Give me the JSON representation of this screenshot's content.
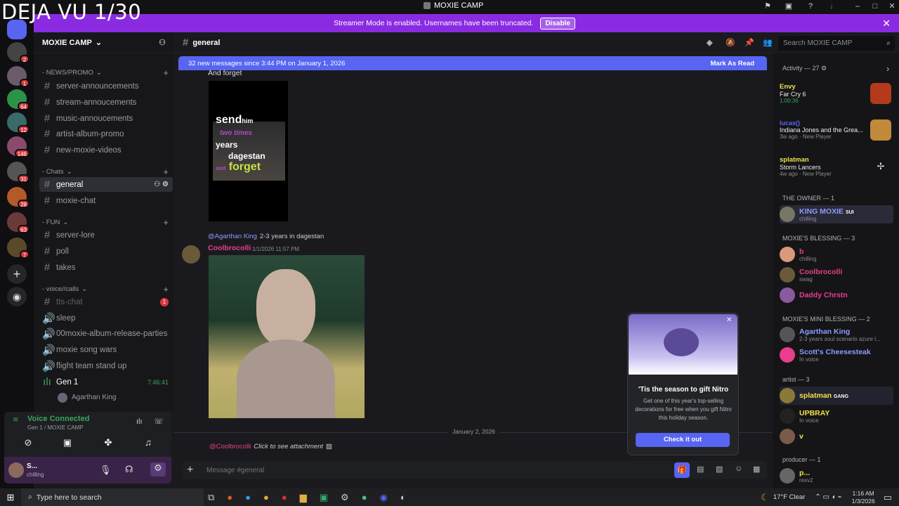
{
  "watermark": "DEJA VU 1/30",
  "window": {
    "title": "MOXIE CAMP"
  },
  "streamer": {
    "text": "Streamer Mode is enabled. Usernames have been truncated.",
    "button": "Disable"
  },
  "server": {
    "name": "MOXIE CAMP"
  },
  "guild_badges": [
    "2",
    "1",
    "64",
    "12",
    "146",
    "31",
    "28",
    "63",
    "7"
  ],
  "categories": {
    "news": "- NEWS/PROMO",
    "chats": "- Chats",
    "fun": "- FUN",
    "voice": "- voice//calls"
  },
  "channels": {
    "news": [
      "server-announcements",
      "stream-annoucements",
      "music-annoucements",
      "artist-album-promo",
      "new-moxie-videos"
    ],
    "chats": [
      "general",
      "moxie-chat"
    ],
    "fun": [
      "server-lore",
      "poll",
      "takes"
    ],
    "voice": [
      "tts-chat",
      "sleep",
      "00moxie-album-release-parties",
      "moxie song wars",
      "flight team stand up"
    ]
  },
  "tts_badge": "1",
  "voice_channel": {
    "name": "Gen 1",
    "timer": "7:46:41",
    "member": "Agarthan King"
  },
  "voice_status": {
    "title": "Voice Connected",
    "sub": "Gen 1 / MOXIE CAMP"
  },
  "user": {
    "name": "S...",
    "status": "chilling"
  },
  "channel_header": "general",
  "new_messages": {
    "text": "32 new messages since 3:44 PM on January 1, 2026",
    "action": "Mark As Read"
  },
  "search": {
    "placeholder": "Search MOXIE CAMP"
  },
  "messages": {
    "top_caption": "And forget",
    "meme_text": [
      "send",
      "him",
      "two times",
      "years",
      "dagestan",
      "and",
      "forget"
    ],
    "reply_target": "@Agarthan King",
    "reply_text": "2-3 years in dagestan",
    "author": "Coolbrocolli",
    "time": "1/1/2026 11:57 PM",
    "date_divider": "January 2, 2026",
    "reply2_target": "@Coolbrocolli",
    "reply2_text": "Click to see attachment"
  },
  "composer": {
    "placeholder": "Message #general"
  },
  "nitro_popup": {
    "title": "'Tis the season to gift Nitro",
    "body": "Get one of this year's top-selling decorations for free when you gift Nitro this holiday season.",
    "button": "Check it out"
  },
  "activity": {
    "header": "Activity — 27",
    "items": [
      {
        "user": "Envy",
        "game": "Far Cry 6",
        "meta": "1:00:36"
      },
      {
        "user": "lucas()",
        "game": "Indiana Jones and the Grea...",
        "meta": "3w ago · New Player"
      },
      {
        "user": "splatman",
        "game": "Storm Lancers",
        "meta": "4w ago · New Player"
      }
    ]
  },
  "member_groups": [
    {
      "header": "THE OWNER — 1",
      "members": [
        {
          "name": "KING MOXIE",
          "tag": "SUI",
          "status": "chilling",
          "color": "#8b9cff"
        }
      ]
    },
    {
      "header": "MOXIE'S BLESSING — 3",
      "members": [
        {
          "name": "b",
          "status": "chilling",
          "color": "#e83e8c"
        },
        {
          "name": "Coolbrocolli",
          "status": "swag",
          "color": "#e83e8c"
        },
        {
          "name": "Daddy Chrstn",
          "status": "",
          "color": "#e83e8c"
        }
      ]
    },
    {
      "header": "MOXIE'S MINI BLESSING — 2",
      "members": [
        {
          "name": "Agarthan King",
          "status": "2-3 years soul scenario azure l...",
          "color": "#8b9cff"
        },
        {
          "name": "Scott's Cheesesteak",
          "status": "In voice",
          "color": "#8b9cff"
        }
      ]
    },
    {
      "header": "artist — 3",
      "members": [
        {
          "name": "splatman",
          "tag": "GANG",
          "status": "",
          "color": "#f0e14a"
        },
        {
          "name": "UPBRAY",
          "status": "In voice",
          "color": "#f0e14a"
        },
        {
          "name": "v",
          "status": "",
          "color": "#f0e14a"
        }
      ]
    },
    {
      "header": "producer — 1",
      "members": [
        {
          "name": "p...",
          "status": "rexv2",
          "color": "#f0e14a"
        }
      ]
    }
  ],
  "taskbar": {
    "search": "Type here to search",
    "weather": "17°F Clear",
    "time": "1:16 AM",
    "date": "1/3/2026"
  }
}
